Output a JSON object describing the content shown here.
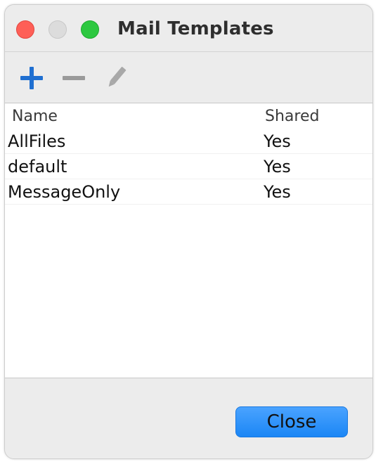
{
  "window": {
    "title": "Mail Templates"
  },
  "toolbar": {
    "add_icon": "plus-icon",
    "remove_icon": "minus-icon",
    "edit_icon": "pencil-icon"
  },
  "table": {
    "columns": [
      "Name",
      "Shared"
    ],
    "rows": [
      {
        "name": "AllFiles",
        "shared": "Yes"
      },
      {
        "name": "default",
        "shared": "Yes"
      },
      {
        "name": "MessageOnly",
        "shared": "Yes"
      }
    ]
  },
  "footer": {
    "close_label": "Close"
  },
  "colors": {
    "accent": "#1b86f5",
    "add_icon": "#1f6fd1",
    "traffic_close": "#fe5f57",
    "traffic_zoom": "#2dc840"
  }
}
